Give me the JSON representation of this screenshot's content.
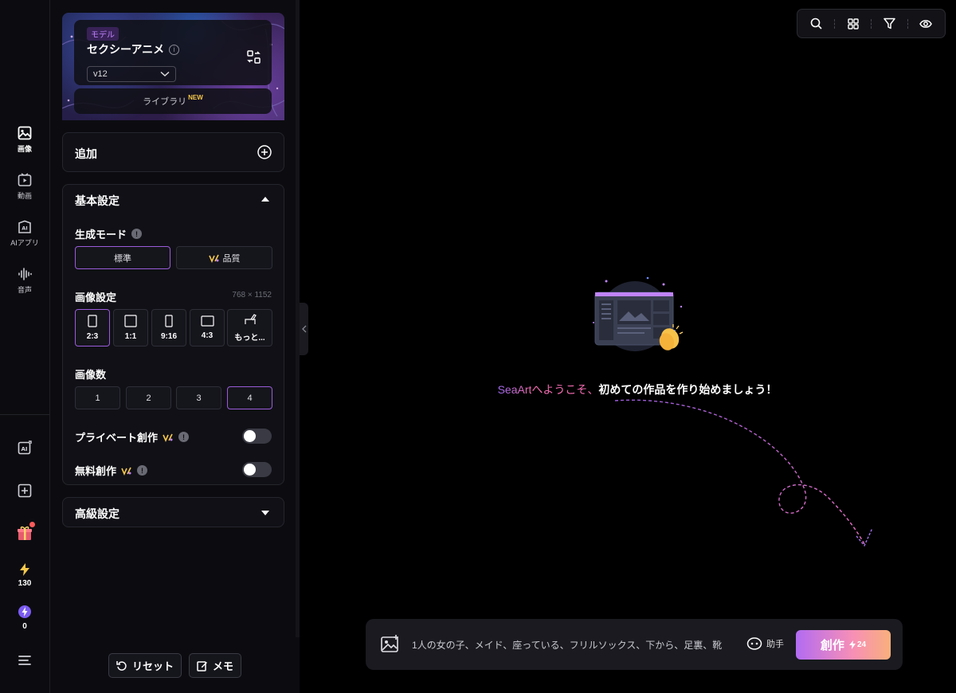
{
  "rail": {
    "items": [
      {
        "label": "画像",
        "icon": "image-icon"
      },
      {
        "label": "動画",
        "icon": "video-icon"
      },
      {
        "label": "AIアプリ",
        "icon": "ai-app-icon"
      },
      {
        "label": "音声",
        "icon": "audio-wave-icon"
      }
    ],
    "credits_energy": "130",
    "credits_stamina": "0"
  },
  "model": {
    "tag": "モデル",
    "name": "セクシーアニメ",
    "info": "i",
    "version": "v12",
    "library_label": "ライブラリ",
    "library_badge": "NEW"
  },
  "add_section": {
    "title": "追加"
  },
  "basic": {
    "title": "基本設定",
    "mode_label": "生成モード",
    "modes": [
      "標準",
      "品質"
    ],
    "image_settings_label": "画像設定",
    "dimensions": "768 × 1152",
    "ratios": [
      "2:3",
      "1:1",
      "9:16",
      "4:3",
      "もっと..."
    ],
    "count_label": "画像数",
    "counts": [
      "1",
      "2",
      "3",
      "4"
    ],
    "private_label": "プライベート創作",
    "free_label": "無料創作"
  },
  "advanced": {
    "title": "高級設定"
  },
  "footer": {
    "reset": "リセット",
    "memo": "メモ"
  },
  "main": {
    "welcome_brand": "SeaArt",
    "welcome_pink": "へようこそ、",
    "welcome_rest": "初めての作品を作り始めましょう！",
    "prompt": "1人の女の子、メイド、座っている、フリルソックス、下から、足裏、靴",
    "assistant_label": "助手",
    "create_label": "創作",
    "create_cost": "24"
  },
  "colors": {
    "accent": "#9a5bd9",
    "pink": "#f06bb0",
    "gold": "#f5c84b"
  }
}
